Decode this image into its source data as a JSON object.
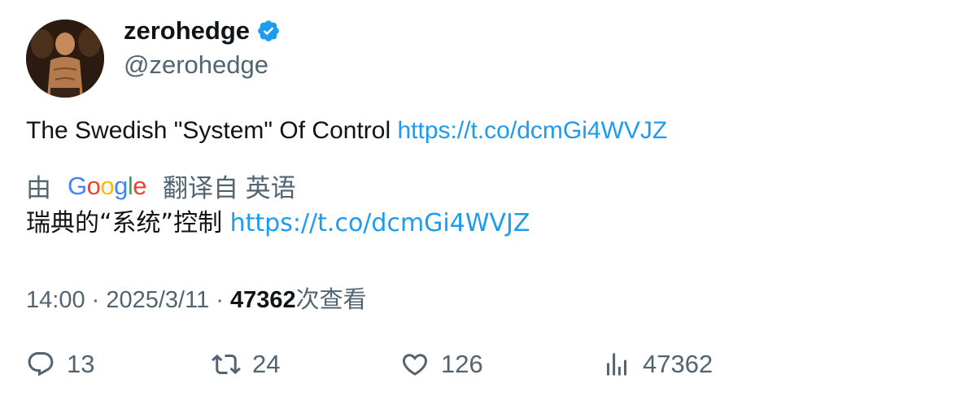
{
  "user": {
    "display_name": "zerohedge",
    "handle": "@zerohedge"
  },
  "tweet": {
    "text": "The Swedish \"System\" Of Control ",
    "link": "https://t.co/dcmGi4WVJZ"
  },
  "translation": {
    "prefix": "由",
    "provider": "Google",
    "suffix": "翻译自 英语",
    "text": "瑞典的“系统”控制 ",
    "link": "https://t.co/dcmGi4WVJZ"
  },
  "meta": {
    "time": "14:00",
    "sep1": " · ",
    "date": "2025/3/11",
    "sep2": " · ",
    "views": "47362",
    "views_label": "次查看"
  },
  "actions": {
    "replies": "13",
    "retweets": "24",
    "likes": "126",
    "views": "47362"
  },
  "colors": {
    "link": "#1d9bf0",
    "muted": "#536471",
    "verified": "#1d9bf0"
  }
}
